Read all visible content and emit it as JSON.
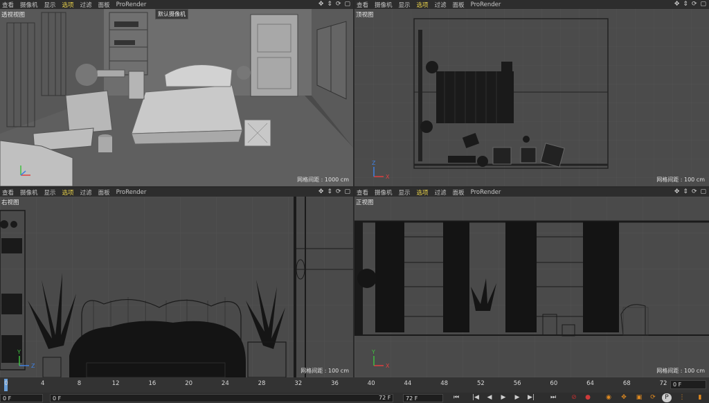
{
  "menu": [
    "查看",
    "摄像机",
    "显示",
    "选项",
    "过滤",
    "面板",
    "ProRender"
  ],
  "active_menu_index": 3,
  "nav_icons": [
    "move-icon",
    "zoom-icon",
    "rotate-icon",
    "maximize-icon"
  ],
  "nav_glyphs": [
    "✥",
    "⇕",
    "⟳",
    "▢"
  ],
  "viewports": {
    "perspective": {
      "label": "透视视图",
      "camera": "默认摄像机",
      "grid": "网格间距 : 1000 cm"
    },
    "top": {
      "label": "顶视图",
      "grid": "网格间距 : 100 cm"
    },
    "right": {
      "label": "右视图",
      "grid": "网格间距 : 100 cm"
    },
    "front": {
      "label": "正视图",
      "grid": "网格间距 : 100 cm"
    }
  },
  "timeline": {
    "ticks": [
      "0",
      "4",
      "8",
      "12",
      "16",
      "20",
      "24",
      "28",
      "32",
      "36",
      "40",
      "44",
      "48",
      "52",
      "56",
      "60",
      "64",
      "68",
      "72"
    ],
    "current_frame": "0 F",
    "start_frame": "0 F",
    "min_frame": "0 F",
    "max_frame": "72 F",
    "end_frame": "72 F"
  },
  "colors": {
    "accent": "#e8d14a",
    "axis_x": "#e04040",
    "axis_y": "#40c040",
    "axis_z": "#4080e0"
  }
}
